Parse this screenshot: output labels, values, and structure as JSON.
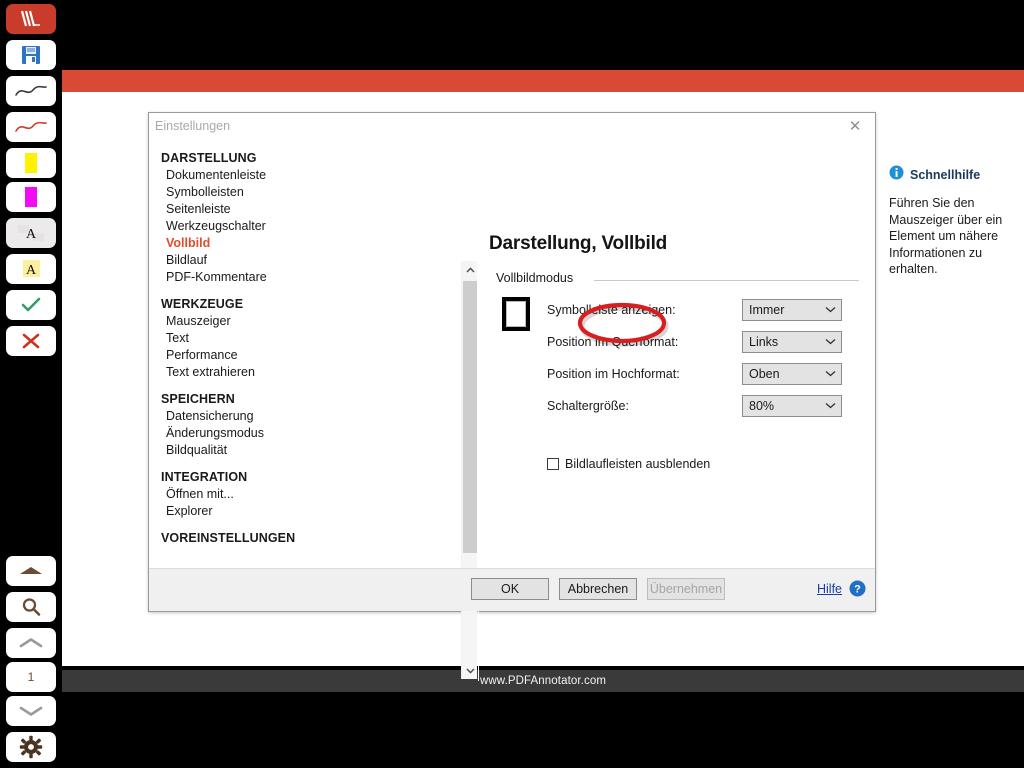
{
  "app": {
    "status_bar_text": "www.PDFAnnotator.com",
    "accent_red": "#d84a35",
    "toolbar_selected_bg": "#eceaea"
  },
  "toolbar": {
    "buttons": [
      {
        "name": "pdfannotator-logo-icon",
        "label": "PDF Annotator",
        "kind": "logo"
      },
      {
        "name": "save-icon",
        "label": "Speichern",
        "kind": "save"
      },
      {
        "name": "pen-black-icon",
        "label": "Stift schwarz",
        "kind": "pen-black"
      },
      {
        "name": "pen-red-icon",
        "label": "Stift rot",
        "kind": "pen-red"
      },
      {
        "name": "highlighter-yellow-icon",
        "label": "Textmarker gelb",
        "kind": "hl-yellow"
      },
      {
        "name": "highlighter-magenta-icon",
        "label": "Textmarker magenta",
        "kind": "hl-magenta"
      },
      {
        "name": "text-tool-icon",
        "label": "Text",
        "kind": "text-plain"
      },
      {
        "name": "text-note-icon",
        "label": "Notiz",
        "kind": "text-note"
      },
      {
        "name": "stamp-check-icon",
        "label": "Haken",
        "kind": "check"
      },
      {
        "name": "stamp-cross-icon",
        "label": "Kreuz",
        "kind": "cross"
      }
    ],
    "bottom_buttons": [
      {
        "name": "page-up-icon",
        "label": "Seite nach oben",
        "kind": "arrow-up-solid"
      },
      {
        "name": "search-icon",
        "label": "Suchen",
        "kind": "magnifier"
      },
      {
        "name": "previous-page-icon",
        "label": "Vorherige Seite",
        "kind": "chevron-up"
      },
      {
        "name": "page-number-field",
        "label": "1",
        "kind": "page-number"
      },
      {
        "name": "next-page-icon",
        "label": "Nächste Seite",
        "kind": "chevron-down"
      },
      {
        "name": "settings-gear-icon",
        "label": "Einstellungen",
        "kind": "gear"
      }
    ],
    "page_number": "1"
  },
  "dialog": {
    "title": "Einstellungen",
    "close_label": "✕",
    "categories": [
      {
        "type": "group",
        "label": "DARSTELLUNG"
      },
      {
        "type": "item",
        "label": "Dokumentenleiste",
        "active": false
      },
      {
        "type": "item",
        "label": "Symbolleisten",
        "active": false
      },
      {
        "type": "item",
        "label": "Seitenleiste",
        "active": false
      },
      {
        "type": "item",
        "label": "Werkzeugschalter",
        "active": false
      },
      {
        "type": "item",
        "label": "Vollbild",
        "active": true
      },
      {
        "type": "item",
        "label": "Bildlauf",
        "active": false
      },
      {
        "type": "item",
        "label": "PDF-Kommentare",
        "active": false
      },
      {
        "type": "group",
        "label": "WERKZEUGE"
      },
      {
        "type": "item",
        "label": "Mauszeiger",
        "active": false
      },
      {
        "type": "item",
        "label": "Text",
        "active": false
      },
      {
        "type": "item",
        "label": "Performance",
        "active": false
      },
      {
        "type": "item",
        "label": "Text extrahieren",
        "active": false
      },
      {
        "type": "group",
        "label": "SPEICHERN"
      },
      {
        "type": "item",
        "label": "Datensicherung",
        "active": false
      },
      {
        "type": "item",
        "label": "Änderungsmodus",
        "active": false
      },
      {
        "type": "item",
        "label": "Bildqualität",
        "active": false
      },
      {
        "type": "group",
        "label": "INTEGRATION"
      },
      {
        "type": "item",
        "label": "Öffnen mit...",
        "active": false
      },
      {
        "type": "item",
        "label": "Explorer",
        "active": false
      },
      {
        "type": "group",
        "label": "VOREINSTELLUNGEN"
      }
    ],
    "panel": {
      "heading": "Darstellung, Vollbild",
      "group_label": "Vollbildmodus",
      "rows": [
        {
          "label": "Symbolleiste anzeigen:",
          "value": "Immer"
        },
        {
          "label": "Position im Querformat:",
          "value": "Links"
        },
        {
          "label": "Position im Hochformat:",
          "value": "Oben"
        },
        {
          "label": "Schaltergröße:",
          "value": "80%"
        }
      ],
      "checkbox": {
        "label": "Bildlaufleisten ausblenden",
        "checked": false
      }
    },
    "quickhelp": {
      "title": "Schnellhilfe",
      "text": "Führen Sie den Mauszeiger über ein Element um nähere Informationen zu erhalten."
    },
    "footer": {
      "ok": "OK",
      "cancel": "Abbrechen",
      "apply": "Übernehmen",
      "apply_disabled": true,
      "help_link": "Hilfe"
    }
  },
  "annotation": {
    "shape": "ellipse",
    "color": "#d81f1f",
    "target": "Schaltergröße dropdown"
  }
}
